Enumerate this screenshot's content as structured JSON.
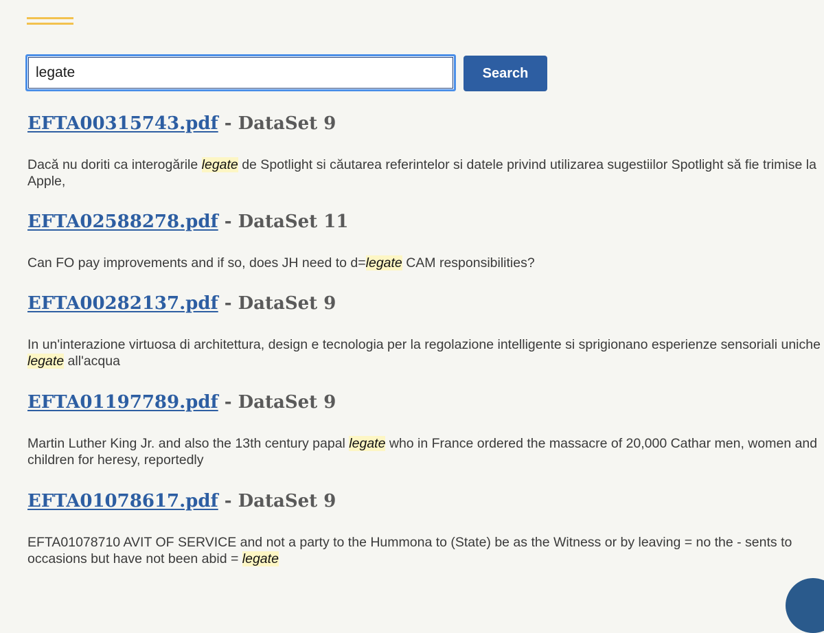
{
  "search": {
    "value": "legate",
    "button_label": "Search"
  },
  "results": [
    {
      "file": "EFTA00315743.pdf",
      "dataset": " - DataSet 9",
      "snippet_before": "Dacă nu doriti ca interogările ",
      "highlight": "legate",
      "snippet_after": " de Spotlight si căutarea referintelor si datele privind utilizarea sugestiilor Spotlight să fie trimise la Apple,"
    },
    {
      "file": "EFTA02588278.pdf",
      "dataset": " - DataSet 11",
      "snippet_before": "Can FO pay improvements and if so, does JH need to d=",
      "highlight": "legate",
      "snippet_after": " CAM responsibilities?"
    },
    {
      "file": "EFTA00282137.pdf",
      "dataset": " - DataSet 9",
      "snippet_before": "In un'interazione virtuosa di architettura, design e tecnologia per la regolazione intelligente si sprigionano esperienze sensoriali uniche ",
      "highlight": "legate",
      "snippet_after": " all'acqua"
    },
    {
      "file": "EFTA01197789.pdf",
      "dataset": " - DataSet 9",
      "snippet_before": "Martin Luther King Jr. and also the 13th century papal ",
      "highlight": "legate",
      "snippet_after": " who in France ordered the massacre of 20,000 Cathar men, women and children for heresy, reportedly"
    },
    {
      "file": "EFTA01078617.pdf",
      "dataset": " - DataSet 9",
      "snippet_before": "EFTA01078710 AVIT OF SERVICE and not a party to the Hummona to (State) be as the Witness or by leaving = no the - sents to occasions but have not been abid = ",
      "highlight": "legate",
      "snippet_after": ""
    }
  ]
}
